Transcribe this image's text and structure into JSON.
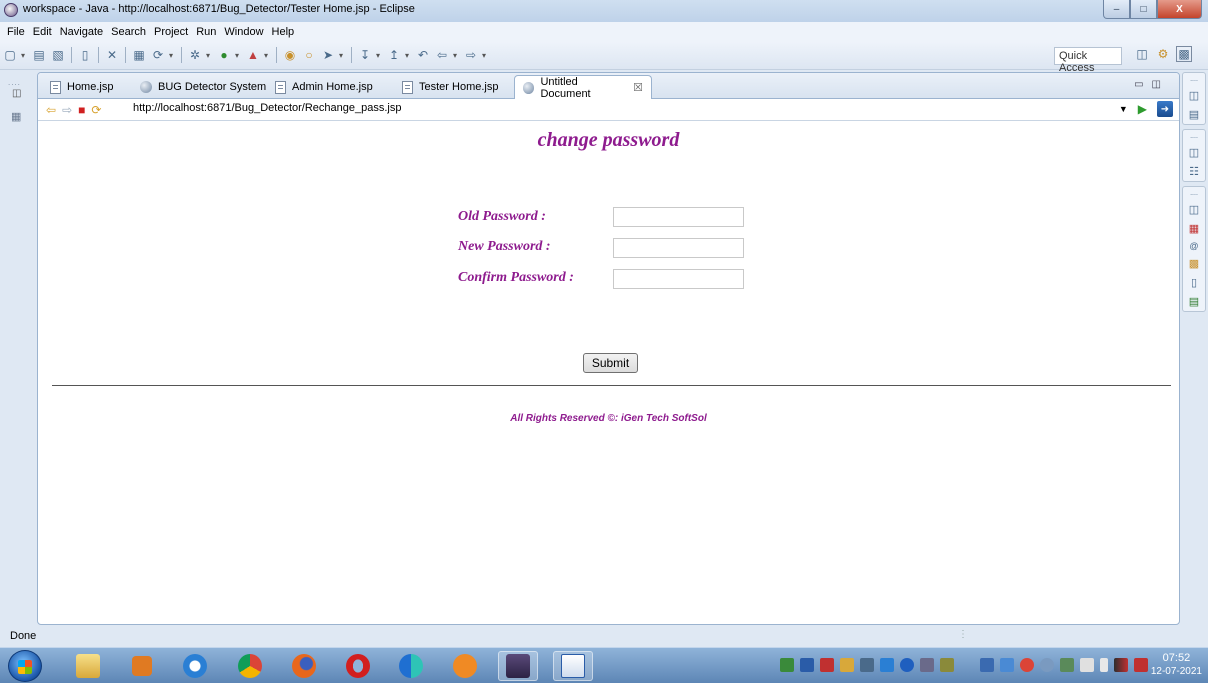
{
  "window": {
    "title": "workspace - Java - http://localhost:6871/Bug_Detector/Tester Home.jsp - Eclipse",
    "min_label": "–",
    "max_label": "□",
    "close_label": "X"
  },
  "menu": [
    "File",
    "Edit",
    "Navigate",
    "Search",
    "Project",
    "Run",
    "Window",
    "Help"
  ],
  "toolbar": {
    "quick_access": "Quick Access"
  },
  "tabs": [
    {
      "label": "Home.jsp",
      "icon": "file-icon"
    },
    {
      "label": "BUG Detector System",
      "icon": "globe-icon"
    },
    {
      "label": "Admin Home.jsp",
      "icon": "file-icon"
    },
    {
      "label": "Tester Home.jsp",
      "icon": "file-icon"
    },
    {
      "label": "Untitled Document",
      "icon": "globe-icon",
      "active": true,
      "close": "☒"
    }
  ],
  "browser": {
    "url": "http://localhost:6871/Bug_Detector/Rechange_pass.jsp"
  },
  "page": {
    "title": "change password",
    "fields": [
      {
        "label": "Old Password :",
        "value": ""
      },
      {
        "label": "New Password :",
        "value": ""
      },
      {
        "label": "Confirm Password :",
        "value": ""
      }
    ],
    "submit_label": "Submit",
    "footer": "All Rights Reserved ©: iGen Tech SoftSol"
  },
  "status": {
    "text": "Done"
  },
  "taskbar": {
    "time": "07:52",
    "date": "12-07-2021"
  }
}
